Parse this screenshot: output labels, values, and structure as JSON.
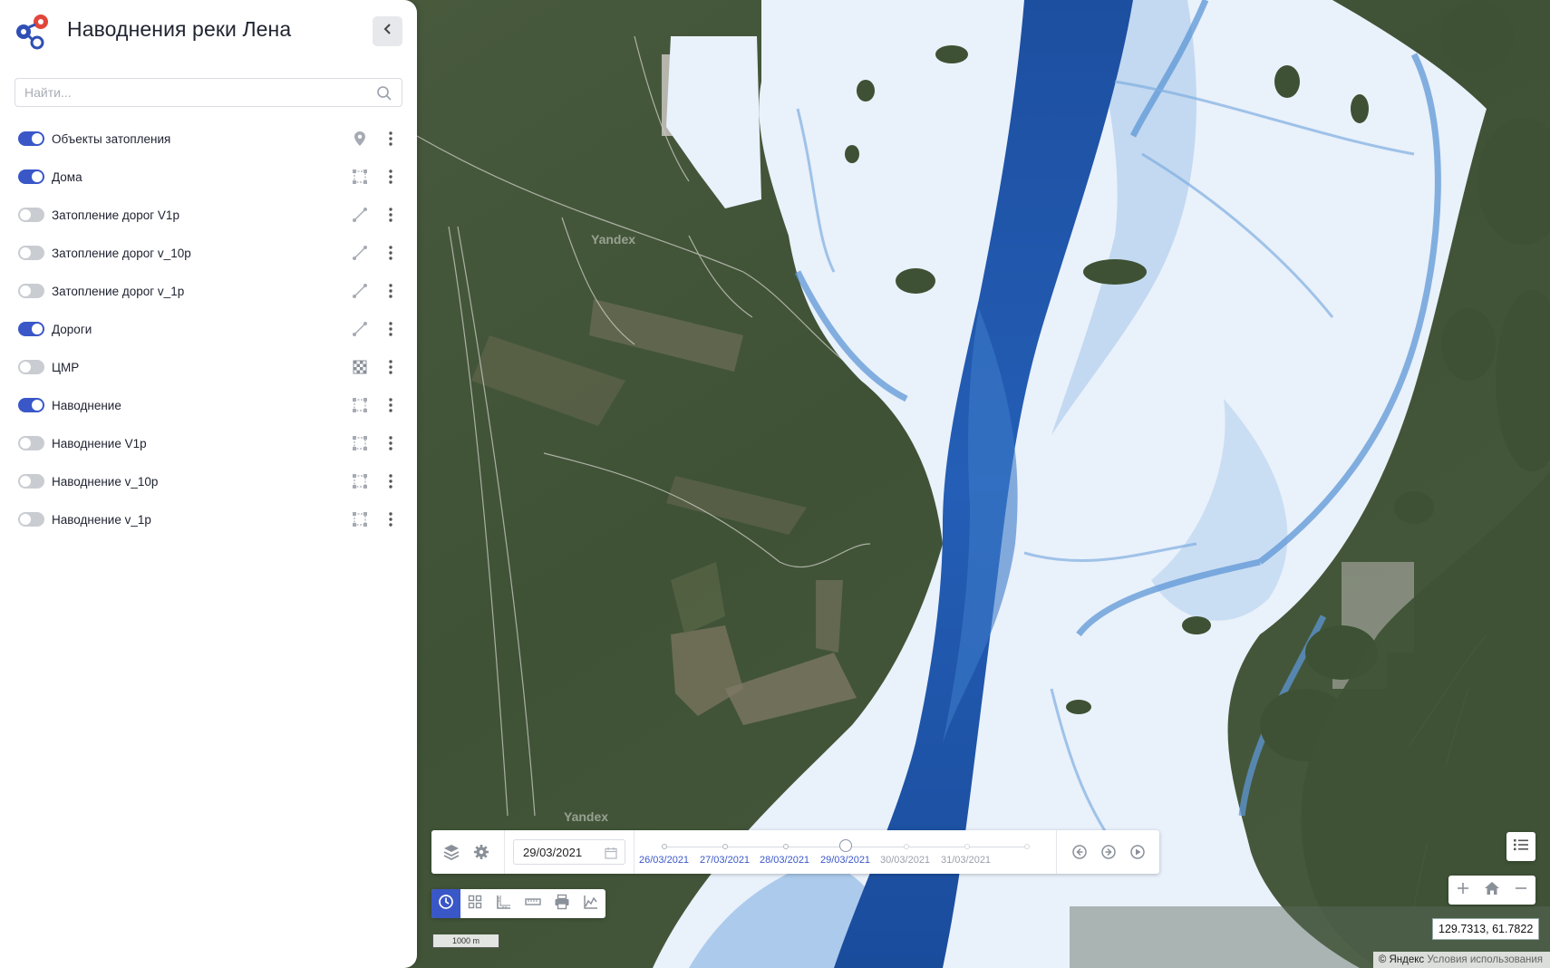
{
  "app": {
    "title": "Наводнения реки Лена"
  },
  "search": {
    "placeholder": "Найти..."
  },
  "layers": [
    {
      "label": "Объекты затопления",
      "on": true,
      "type": "point"
    },
    {
      "label": "Дома",
      "on": true,
      "type": "polygon"
    },
    {
      "label": "Затопление дорог V1p",
      "on": false,
      "type": "line"
    },
    {
      "label": "Затопление дорог v_10p",
      "on": false,
      "type": "line"
    },
    {
      "label": "Затопление дорог v_1p",
      "on": false,
      "type": "line"
    },
    {
      "label": "Дороги",
      "on": true,
      "type": "line"
    },
    {
      "label": "ЦМР",
      "on": false,
      "type": "raster"
    },
    {
      "label": "Наводнение",
      "on": true,
      "type": "polygon"
    },
    {
      "label": "Наводнение V1p",
      "on": false,
      "type": "polygon"
    },
    {
      "label": "Наводнение v_10p",
      "on": false,
      "type": "polygon"
    },
    {
      "label": "Наводнение v_1p",
      "on": false,
      "type": "polygon"
    }
  ],
  "timeline": {
    "current_date": "29/03/2021",
    "dates": [
      {
        "label": "26/03/2021",
        "active": true
      },
      {
        "label": "27/03/2021",
        "active": true
      },
      {
        "label": "28/03/2021",
        "active": true
      },
      {
        "label": "29/03/2021",
        "active": true,
        "current": true
      },
      {
        "label": "30/03/2021",
        "active": false
      },
      {
        "label": "31/03/2021",
        "active": false
      }
    ]
  },
  "map": {
    "watermark": "Yandex",
    "scale_label": "1000 m",
    "coordinates": "129.7313, 61.7822",
    "attribution_brand": "© Яндекс",
    "attribution_link": "Условия использования"
  },
  "colors": {
    "accent": "#3a57c8",
    "flood_light": "#e8f1fb",
    "flood_deep": "#1f55a8"
  },
  "icons": {
    "collapse": "chevron-left-icon",
    "search": "search-icon",
    "more": "kebab-menu-icon",
    "point": "map-pin-icon",
    "polygon": "polygon-icon",
    "line": "line-icon",
    "raster": "raster-icon",
    "layers": "layers-icon",
    "settings": "gear-icon",
    "calendar": "calendar-icon",
    "prev": "arrow-left-circle-icon",
    "next": "arrow-right-circle-icon",
    "play": "play-circle-icon",
    "legend": "list-icon",
    "zoom_in": "plus-icon",
    "home": "home-icon",
    "zoom_out": "minus-icon"
  }
}
